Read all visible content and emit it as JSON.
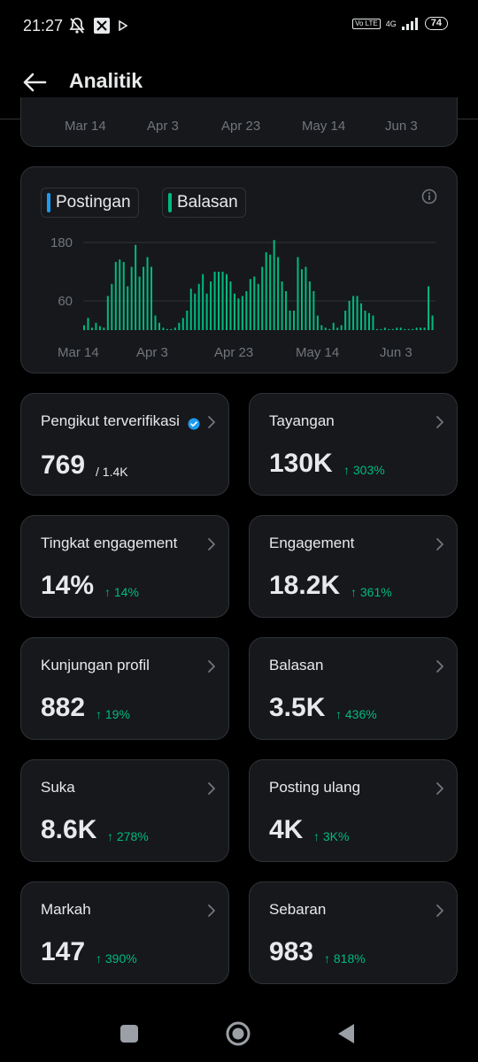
{
  "status": {
    "time": "21:27",
    "network": "4G",
    "volte": "Vo LTE",
    "battery": "74"
  },
  "header": {
    "title": "Analitik"
  },
  "top_chart": {
    "x_labels": [
      "Mar 14",
      "Apr 3",
      "Apr 23",
      "May 14",
      "Jun 3"
    ]
  },
  "activity_chart": {
    "legend": [
      {
        "label": "Postingan",
        "color": "#1d9bf0"
      },
      {
        "label": "Balasan",
        "color": "#00ba7c"
      }
    ]
  },
  "chart_data": {
    "type": "bar",
    "x_tick_labels": [
      "Mar 14",
      "Apr 3",
      "Apr 23",
      "May 14",
      "Jun 3"
    ],
    "y_tick_labels": [
      "60",
      "180"
    ],
    "ylim": [
      0,
      200
    ],
    "grid": true,
    "series": [
      {
        "name": "Balasan",
        "color": "#00ba7c",
        "values": [
          10,
          25,
          5,
          15,
          8,
          5,
          70,
          95,
          140,
          145,
          140,
          90,
          130,
          175,
          110,
          130,
          150,
          130,
          30,
          15,
          5,
          0,
          0,
          5,
          15,
          25,
          40,
          85,
          75,
          95,
          115,
          75,
          100,
          120,
          120,
          120,
          115,
          100,
          75,
          65,
          70,
          80,
          105,
          110,
          95,
          130,
          160,
          155,
          185,
          150,
          100,
          80,
          40,
          40,
          150,
          125,
          130,
          100,
          80,
          30,
          10,
          5,
          0,
          15,
          5,
          10,
          40,
          60,
          70,
          70,
          55,
          40,
          35,
          30,
          0,
          0,
          5,
          0,
          0,
          5,
          5,
          0,
          0,
          0,
          5,
          5,
          5,
          90,
          30
        ]
      },
      {
        "name": "Postingan",
        "color": "#1d9bf0",
        "values": [
          0,
          0,
          0,
          0,
          0,
          0,
          0,
          0,
          0,
          0,
          0,
          0,
          0,
          0,
          0,
          0,
          0,
          0,
          0,
          0,
          0,
          0,
          0,
          0,
          0,
          0,
          0,
          0,
          0,
          0,
          0,
          0,
          0,
          0,
          0,
          0,
          0,
          0,
          0,
          0,
          0,
          0,
          0,
          0,
          0,
          0,
          0,
          0,
          0,
          0,
          0,
          0,
          0,
          0,
          0,
          0,
          0,
          0,
          0,
          0,
          0,
          0,
          0,
          0,
          0,
          0,
          0,
          0,
          0,
          0,
          0,
          0,
          0,
          0,
          0,
          0,
          0,
          0,
          0,
          0,
          0,
          0,
          0,
          0,
          0,
          0,
          0,
          0,
          0
        ]
      }
    ]
  },
  "tiles": [
    {
      "label": "Pengikut terverifikasi",
      "value": "769",
      "sub": "/ 1.4K",
      "verified_icon": true
    },
    {
      "label": "Tayangan",
      "value": "130K",
      "pct": "↑ 303%"
    },
    {
      "label": "Tingkat engagement",
      "value": "14%",
      "pct": "↑ 14%"
    },
    {
      "label": "Engagement",
      "value": "18.2K",
      "pct": "↑ 361%"
    },
    {
      "label": "Kunjungan profil",
      "value": "882",
      "pct": "↑ 19%"
    },
    {
      "label": "Balasan",
      "value": "3.5K",
      "pct": "↑ 436%"
    },
    {
      "label": "Suka",
      "value": "8.6K",
      "pct": "↑ 278%"
    },
    {
      "label": "Posting ulang",
      "value": "4K",
      "pct": "↑ 3K%"
    },
    {
      "label": "Markah",
      "value": "147",
      "pct": "↑ 390%"
    },
    {
      "label": "Sebaran",
      "value": "983",
      "pct": "↑ 818%"
    }
  ],
  "icons": {
    "back": "back-arrow-icon",
    "info": "info-icon",
    "chevron": "chevron-right-icon",
    "verified": "verified-badge-icon"
  }
}
